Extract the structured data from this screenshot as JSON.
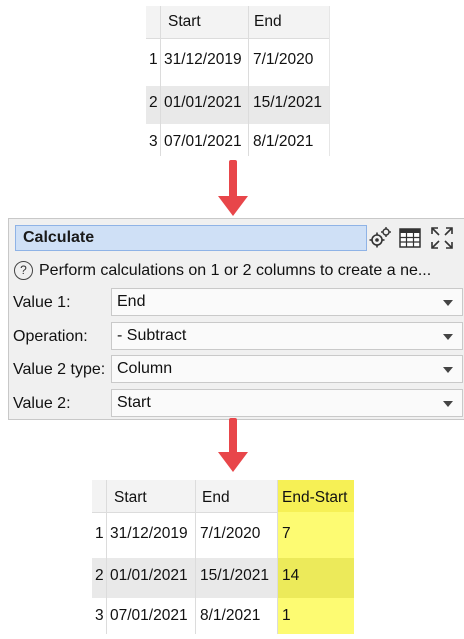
{
  "input_table": {
    "columns": [
      "Start",
      "End"
    ],
    "rows": [
      {
        "num": "1",
        "start": "31/12/2019",
        "end": "7/1/2020"
      },
      {
        "num": "2",
        "start": "01/01/2021",
        "end": "15/1/2021"
      },
      {
        "num": "3",
        "start": "07/01/2021",
        "end": "8/1/2021"
      }
    ]
  },
  "calculate_panel": {
    "title": "Calculate",
    "description": "Perform calculations on 1 or 2 columns to create a ne...",
    "help_icon": "?",
    "toolbar_icons": [
      "settings-gears-icon",
      "table-icon",
      "maximize-icon"
    ],
    "fields": [
      {
        "label": "Value 1:",
        "value": "End"
      },
      {
        "label": "Operation:",
        "value": "- Subtract"
      },
      {
        "label": "Value 2 type:",
        "value": "Column"
      },
      {
        "label": "Value 2:",
        "value": "Start"
      }
    ]
  },
  "output_table": {
    "columns": [
      "Start",
      "End",
      "End-Start"
    ],
    "rows": [
      {
        "num": "1",
        "start": "31/12/2019",
        "end": "7/1/2020",
        "diff": "7"
      },
      {
        "num": "2",
        "start": "01/01/2021",
        "end": "15/1/2021",
        "diff": "14"
      },
      {
        "num": "3",
        "start": "07/01/2021",
        "end": "8/1/2021",
        "diff": "1"
      }
    ],
    "highlight_color": "#fdfb72"
  },
  "colors": {
    "arrow": "#e8464a",
    "title_bar": "#cfe0f6"
  }
}
